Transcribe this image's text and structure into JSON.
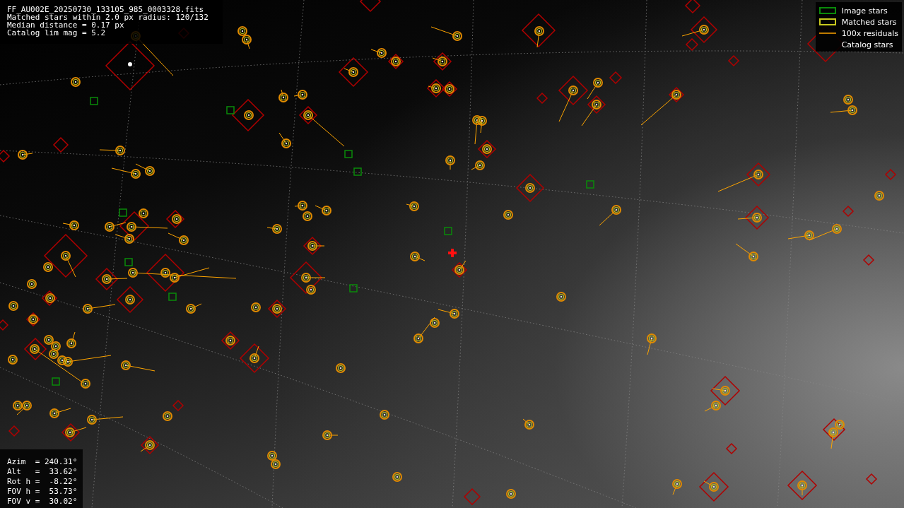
{
  "info_lines": [
    "FF_AU002E_20250730_133105_985_0003328.fits",
    "Matched stars within 2.0 px radius: 120/132",
    "Median distance = 0.17 px",
    "Catalog lim mag = 5.2"
  ],
  "legend": [
    {
      "kind": "image",
      "label": "Image stars"
    },
    {
      "kind": "matched",
      "label": "Matched stars"
    },
    {
      "kind": "residual",
      "label": "100x residuals"
    },
    {
      "kind": "catalog",
      "label": "Catalog stars"
    }
  ],
  "pointing": [
    "Azim  = 240.31°",
    "Alt   =  33.62°",
    "Rot h =  -8.22°",
    "FOV h =  53.73°",
    "FOV v =  30.02°"
  ]
}
